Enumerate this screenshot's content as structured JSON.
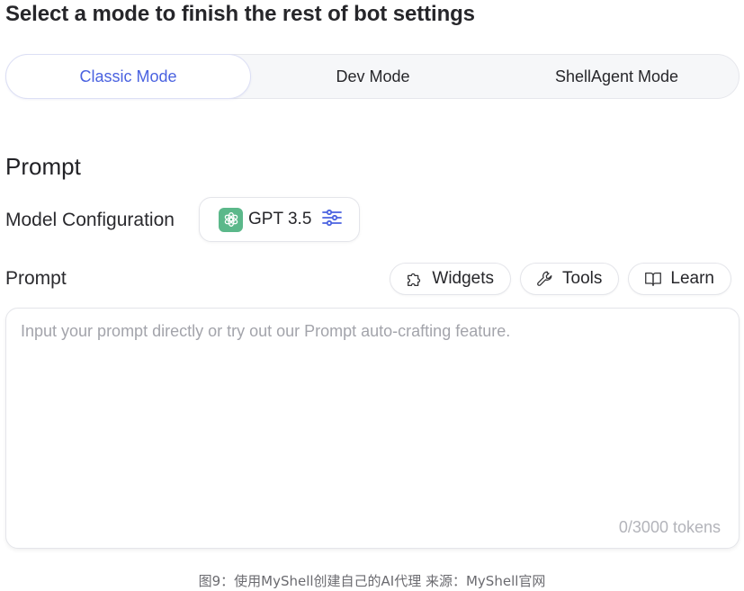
{
  "header": {
    "title": "Select a mode to finish the rest of bot settings"
  },
  "modes": {
    "tabs": [
      {
        "label": "Classic Mode",
        "active": true
      },
      {
        "label": "Dev Mode",
        "active": false
      },
      {
        "label": "ShellAgent Mode",
        "active": false
      }
    ],
    "active_color": "#4a62e0"
  },
  "prompt_section": {
    "heading": "Prompt",
    "model_configuration": {
      "label": "Model Configuration",
      "model_name": "GPT 3.5",
      "model_icon": "openai-logo-icon",
      "settings_icon": "sliders-icon"
    },
    "prompt_label": "Prompt",
    "actions": [
      {
        "label": "Widgets",
        "icon": "puzzle-icon"
      },
      {
        "label": "Tools",
        "icon": "wrench-icon"
      },
      {
        "label": "Learn",
        "icon": "book-icon"
      }
    ],
    "input": {
      "value": "",
      "placeholder": "Input your prompt directly or try out our Prompt auto-crafting feature."
    },
    "token_counter": "0/3000 tokens"
  },
  "caption": "图9：使用MyShell创建自己的AI代理 来源：MyShell官网"
}
